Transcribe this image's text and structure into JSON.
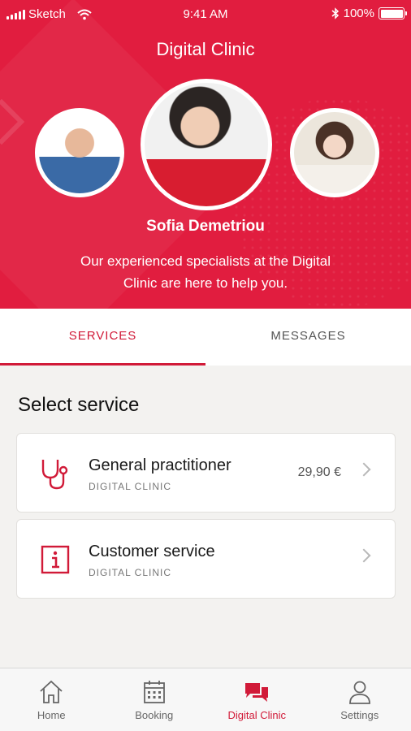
{
  "status_bar": {
    "carrier": "Sketch",
    "time": "9:41 AM",
    "battery": "100%"
  },
  "header": {
    "title": "Digital Clinic",
    "featured_name": "Sofia Demetriou",
    "description": "Our experienced specialists at the Digital Clinic are here to help you."
  },
  "tabs": [
    {
      "label": "SERVICES",
      "active": true
    },
    {
      "label": "MESSAGES",
      "active": false
    }
  ],
  "section_title": "Select service",
  "services": [
    {
      "title": "General practitioner",
      "subtitle": "DIGITAL CLINIC",
      "price": "29,90 €",
      "icon": "stethoscope-icon"
    },
    {
      "title": "Customer service",
      "subtitle": "DIGITAL CLINIC",
      "price": "",
      "icon": "info-icon"
    }
  ],
  "bottom_nav": [
    {
      "label": "Home",
      "icon": "home-icon",
      "active": false
    },
    {
      "label": "Booking",
      "icon": "calendar-icon",
      "active": false
    },
    {
      "label": "Digital Clinic",
      "icon": "chat-icon",
      "active": true
    },
    {
      "label": "Settings",
      "icon": "user-icon",
      "active": false
    }
  ],
  "colors": {
    "accent": "#e11d3f",
    "active_text": "#d11a38"
  }
}
